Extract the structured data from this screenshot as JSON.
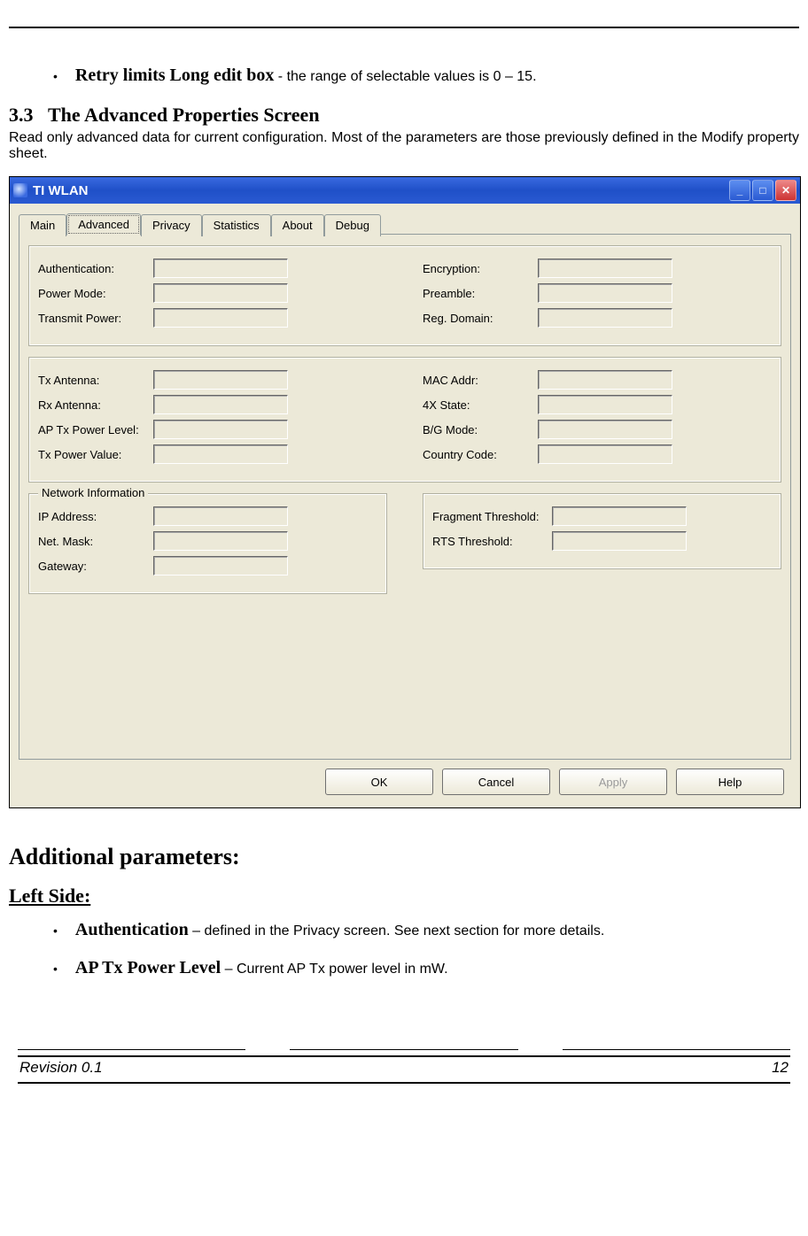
{
  "doc": {
    "first_bullet_bold": "Retry limits Long edit box",
    "first_bullet_rest": " - the range of selectable values is 0 – 15.",
    "section_number": "3.3",
    "section_title": "The Advanced Properties Screen",
    "section_body": "Read only advanced data for current configuration. Most of the parameters are those previously defined in the Modify property sheet.",
    "additional_heading": "Additional parameters:",
    "left_side_heading": "Left Side:",
    "bullet_auth_bold": "Authentication",
    "bullet_auth_rest": " – defined in the Privacy screen. See next section for more details.",
    "bullet_aptx_bold": "AP Tx Power Level",
    "bullet_aptx_rest": " – Current AP Tx power level in mW.",
    "footer_left": " Revision 0.1",
    "footer_right": "12"
  },
  "window": {
    "title": "TI WLAN",
    "tabs": [
      "Main",
      "Advanced",
      "Privacy",
      "Statistics",
      "About",
      "Debug"
    ],
    "group1_left": [
      "Authentication:",
      "Power Mode:",
      "Transmit Power:"
    ],
    "group1_right": [
      "Encryption:",
      "Preamble:",
      "Reg. Domain:"
    ],
    "group2_left": [
      "Tx Antenna:",
      "Rx Antenna:",
      "AP Tx Power Level:",
      "Tx Power Value:"
    ],
    "group2_right": [
      "MAC Addr:",
      "4X State:",
      "B/G Mode:",
      "Country Code:"
    ],
    "group3_legend": "Network Information",
    "group3_left": [
      "IP Address:",
      "Net. Mask:",
      "Gateway:"
    ],
    "group3_right": [
      "Fragment Threshold:",
      "RTS Threshold:"
    ],
    "buttons": {
      "ok": "OK",
      "cancel": "Cancel",
      "apply": "Apply",
      "help": "Help"
    }
  }
}
